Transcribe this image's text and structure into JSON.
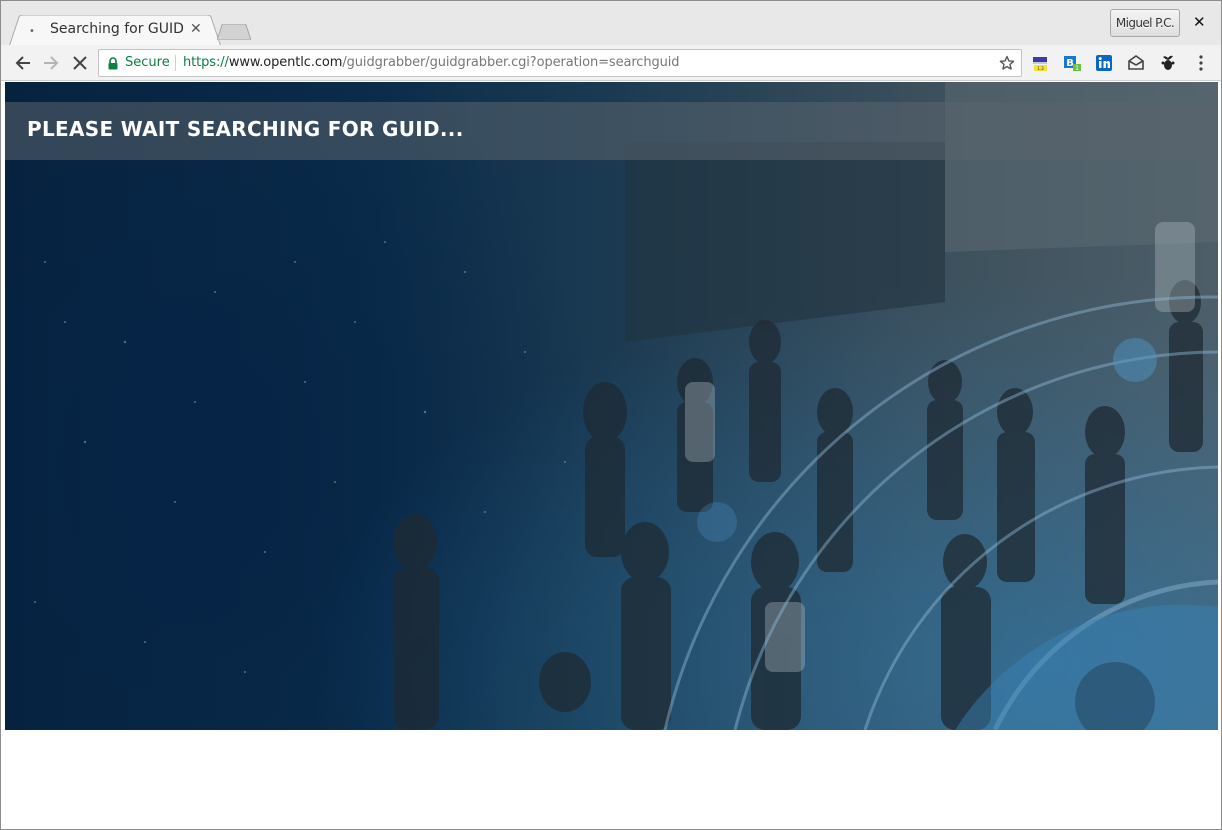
{
  "browser": {
    "tab": {
      "title": "Searching for GUID"
    },
    "profile_name": "Miguel P.C.",
    "addressbar": {
      "security_label": "Secure",
      "url_scheme": "https://",
      "url_host": "www.opentlc.com",
      "url_path": "/guidgrabber/guidgrabber.cgi?operation=searchguid"
    },
    "extensions": [
      "flag-extension-icon",
      "b-extension-icon",
      "linkedin-icon",
      "mail-extension-icon",
      "gnome-extension-icon"
    ],
    "loading": true
  },
  "page": {
    "banner_title": "PLEASE WAIT SEARCHING FOR GUID..."
  },
  "colors": {
    "secure_green": "#0b8043",
    "banner_bg": "#5a646e",
    "hero_dark": "#07223d"
  }
}
